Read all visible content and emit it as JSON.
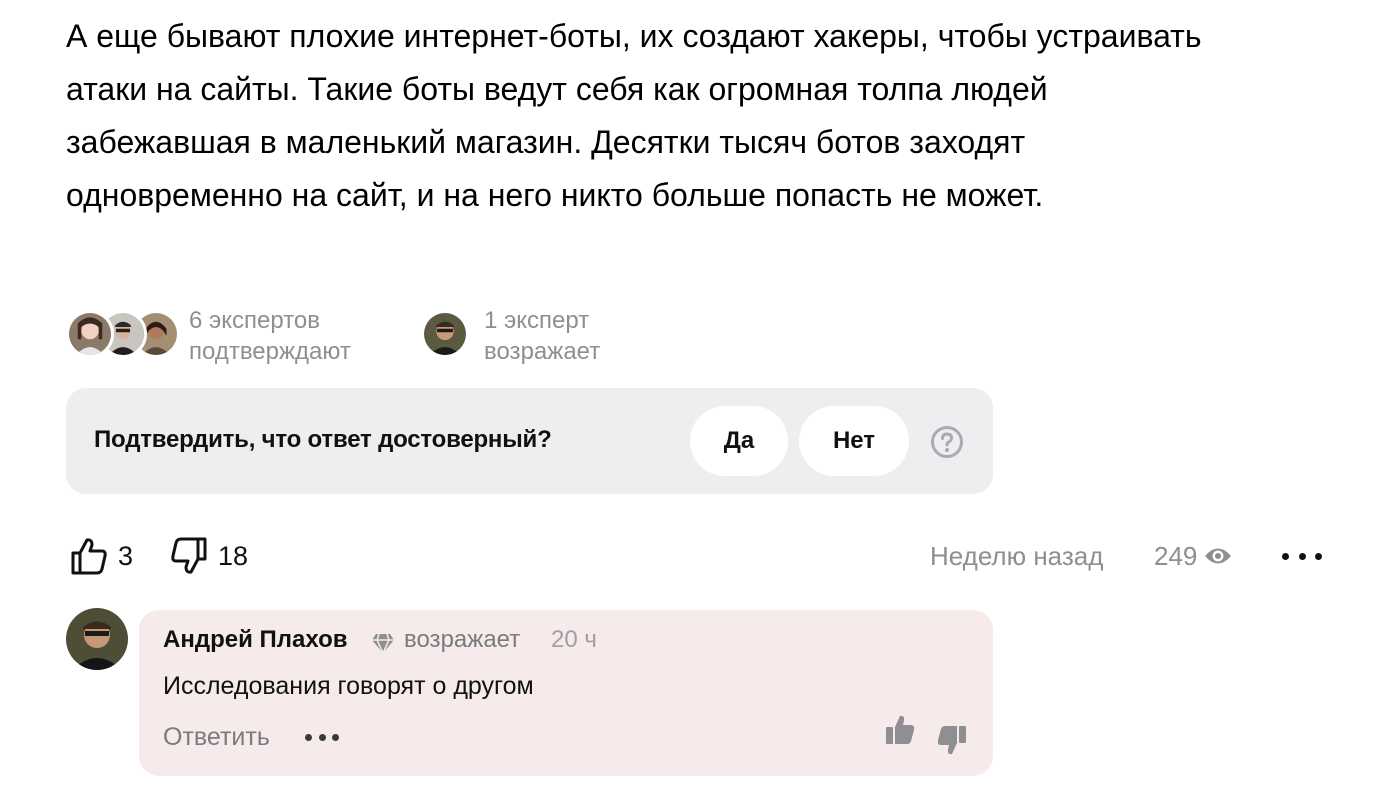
{
  "answer": {
    "line1": "А еще бывают плохие интернет-боты, их создают хакеры, чтобы устраивать",
    "line2": "атаки на сайты. Такие боты ведут себя как огромная толпа людей",
    "line3": "забежавшая в маленький магазин. Десятки тысяч ботов заходят",
    "line4": "одновременно на сайт, и на него никто больше попасть не может."
  },
  "experts": {
    "confirm": {
      "line1": "6 экспертов",
      "line2": "подтверждают"
    },
    "object": {
      "line1": "1 эксперт",
      "line2": "возражает"
    }
  },
  "confirm_box": {
    "question": "Подтвердить, что ответ достоверный?",
    "yes_label": "Да",
    "no_label": "Нет",
    "help_icon": "question-circle-icon"
  },
  "actions": {
    "likes": "3",
    "dislikes": "18",
    "time": "Неделю назад",
    "views": "249",
    "icons": [
      "thumbs-up-icon",
      "thumbs-down-icon",
      "eye-icon",
      "more-icon"
    ]
  },
  "comment": {
    "author": "Андрей Плахов",
    "badge_icon": "diamond-icon",
    "status": "возражает",
    "time": "20 ч",
    "text": "Исследования говорят о другом",
    "reply_label": "Ответить"
  },
  "colors": {
    "muted_text": "#8e8e93",
    "confirm_bg": "#eceef0",
    "comment_bg": "#f6ebea"
  }
}
